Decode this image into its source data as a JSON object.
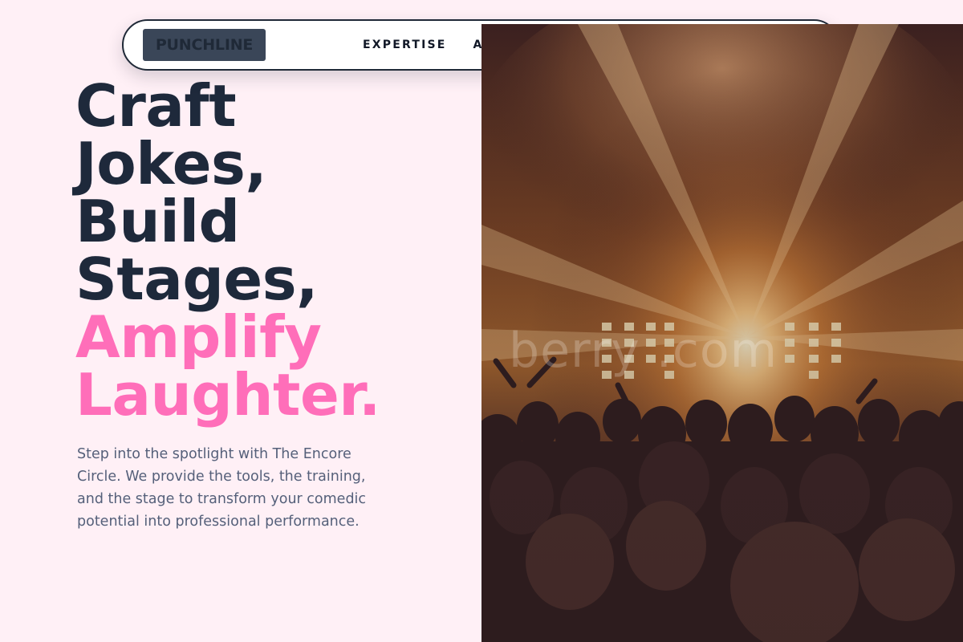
{
  "nav": {
    "logo": "PUNCHLINE",
    "links": [
      "EXPERTISE",
      "AB"
    ]
  },
  "hero": {
    "title_lines": [
      "Craft",
      "Jokes,",
      "Build",
      "Stages,"
    ],
    "accent_lines": [
      "Amplify",
      "Laughter."
    ],
    "description": "Step into the spotlight with The Encore Circle. We provide the tools, the training, and the stage to transform your comedic potential into professional performance.",
    "image_watermark": "berry   .com"
  },
  "colors": {
    "background": "#fff0f6",
    "heading": "#1e293b",
    "accent": "#ff6eb9",
    "body_text": "#55607a",
    "logo_bg": "#3a4658"
  }
}
